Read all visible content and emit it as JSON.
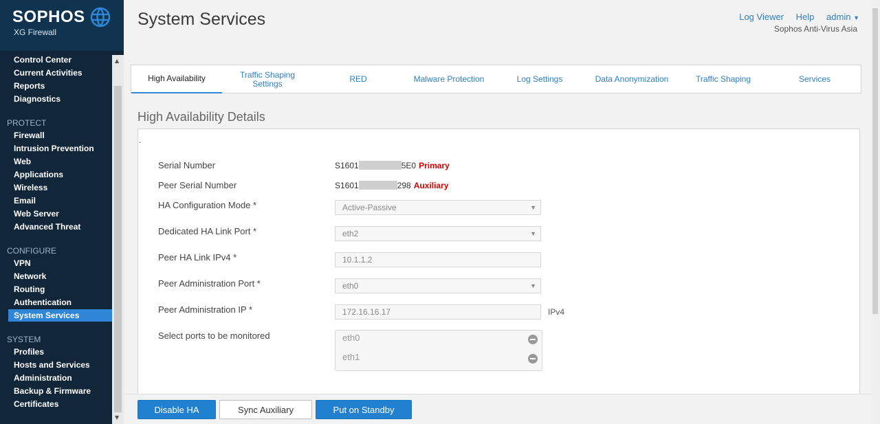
{
  "brand": {
    "name": "SOPHOS",
    "product": "XG Firewall",
    "logo_icon": "globe-icon"
  },
  "sidebar": {
    "top_items": [
      "Control Center",
      "Current Activities",
      "Reports",
      "Diagnostics"
    ],
    "protect": {
      "title": "PROTECT",
      "items": [
        "Firewall",
        "Intrusion Prevention",
        "Web",
        "Applications",
        "Wireless",
        "Email",
        "Web Server",
        "Advanced Threat"
      ]
    },
    "configure": {
      "title": "CONFIGURE",
      "items": [
        "VPN",
        "Network",
        "Routing",
        "Authentication",
        "System Services"
      ]
    },
    "system": {
      "title": "SYSTEM",
      "items": [
        "Profiles",
        "Hosts and Services",
        "Administration",
        "Backup & Firmware",
        "Certificates"
      ]
    },
    "active_item": "System Services"
  },
  "header": {
    "title": "System Services",
    "links": {
      "log_viewer": "Log Viewer",
      "help": "Help",
      "user": "admin"
    },
    "org": "Sophos Anti-Virus Asia"
  },
  "tabs": [
    {
      "label": "High Availability",
      "active": true
    },
    {
      "label": "Traffic Shaping Settings",
      "active": false
    },
    {
      "label": "RED",
      "active": false
    },
    {
      "label": "Malware Protection",
      "active": false
    },
    {
      "label": "Log Settings",
      "active": false
    },
    {
      "label": "Data Anonymization",
      "active": false
    },
    {
      "label": "Traffic Shaping",
      "active": false
    },
    {
      "label": "Services",
      "active": false
    }
  ],
  "section": {
    "title": "High Availability Details",
    "dot": ".",
    "serial": {
      "label": "Serial Number",
      "prefix": "S1601",
      "suffix": "5E0",
      "role": "Primary"
    },
    "peer_serial": {
      "label": "Peer Serial Number",
      "prefix": "S1601",
      "suffix": "298",
      "role": "Auxiliary"
    },
    "ha_mode": {
      "label": "HA Configuration Mode *",
      "value": "Active-Passive"
    },
    "ha_link_port": {
      "label": "Dedicated HA Link Port *",
      "value": "eth2"
    },
    "peer_ha_ip": {
      "label": "Peer HA Link IPv4 *",
      "value": "10.1.1.2"
    },
    "peer_admin_port": {
      "label": "Peer Administration Port *",
      "value": "eth0"
    },
    "peer_admin_ip": {
      "label": "Peer Administration IP *",
      "value": "172.16.16.17",
      "unit": "IPv4"
    },
    "monitored_ports": {
      "label": "Select ports to be monitored",
      "ports": [
        "eth0",
        "eth1"
      ]
    }
  },
  "buttons": {
    "disable_ha": "Disable HA",
    "sync_aux": "Sync Auxiliary",
    "standby": "Put on Standby"
  }
}
